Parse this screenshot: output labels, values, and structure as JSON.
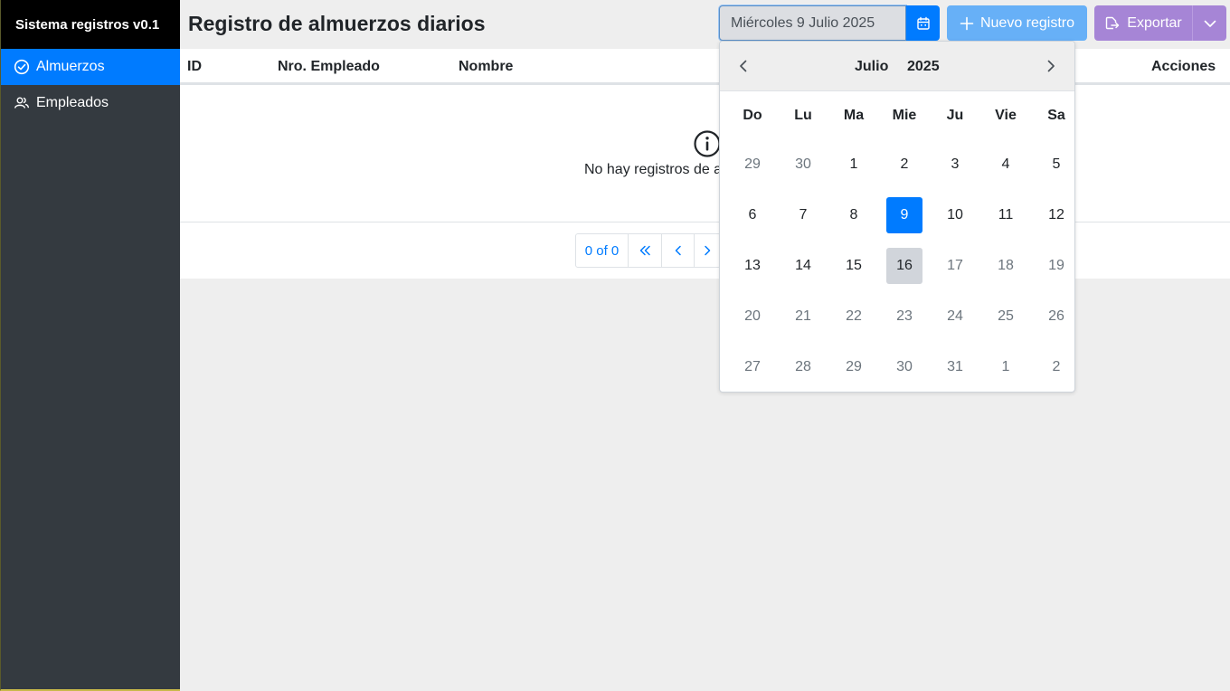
{
  "app": {
    "title": "Sistema registros v0.1"
  },
  "sidebar": {
    "items": [
      {
        "label": "Almuerzos",
        "icon": "check-circle-icon"
      },
      {
        "label": "Empleados",
        "icon": "users-icon"
      }
    ]
  },
  "header": {
    "title": "Registro de almuerzos diarios",
    "date_value": "Miércoles 9 Julio 2025",
    "new_label": "Nuevo registro",
    "export_label": "Exportar"
  },
  "table": {
    "columns": [
      "ID",
      "Nro. Empleado",
      "Nombre",
      "Acciones"
    ],
    "empty_message": "No hay registros de almuerzos",
    "pager_text": "0 of 0"
  },
  "calendar": {
    "month": "Julio",
    "year": "2025",
    "weekdays": [
      "Do",
      "Lu",
      "Ma",
      "Mie",
      "Ju",
      "Vie",
      "Sa"
    ],
    "days": [
      {
        "d": "29",
        "s": "muted"
      },
      {
        "d": "30",
        "s": "muted"
      },
      {
        "d": "1",
        "s": ""
      },
      {
        "d": "2",
        "s": ""
      },
      {
        "d": "3",
        "s": ""
      },
      {
        "d": "4",
        "s": ""
      },
      {
        "d": "5",
        "s": ""
      },
      {
        "d": "6",
        "s": ""
      },
      {
        "d": "7",
        "s": ""
      },
      {
        "d": "8",
        "s": ""
      },
      {
        "d": "9",
        "s": "selected"
      },
      {
        "d": "10",
        "s": ""
      },
      {
        "d": "11",
        "s": ""
      },
      {
        "d": "12",
        "s": ""
      },
      {
        "d": "13",
        "s": ""
      },
      {
        "d": "14",
        "s": ""
      },
      {
        "d": "15",
        "s": ""
      },
      {
        "d": "16",
        "s": "today"
      },
      {
        "d": "17",
        "s": "muted"
      },
      {
        "d": "18",
        "s": "muted"
      },
      {
        "d": "19",
        "s": "muted"
      },
      {
        "d": "20",
        "s": "muted"
      },
      {
        "d": "21",
        "s": "muted"
      },
      {
        "d": "22",
        "s": "muted"
      },
      {
        "d": "23",
        "s": "muted"
      },
      {
        "d": "24",
        "s": "muted"
      },
      {
        "d": "25",
        "s": "muted"
      },
      {
        "d": "26",
        "s": "muted"
      },
      {
        "d": "27",
        "s": "muted"
      },
      {
        "d": "28",
        "s": "muted"
      },
      {
        "d": "29",
        "s": "muted"
      },
      {
        "d": "30",
        "s": "muted"
      },
      {
        "d": "31",
        "s": "muted"
      },
      {
        "d": "1",
        "s": "muted"
      },
      {
        "d": "2",
        "s": "muted"
      }
    ]
  },
  "colors": {
    "primary": "#007bff",
    "sidebar": "#343a40",
    "export": "#a685d6",
    "new": "#67b0f7"
  }
}
